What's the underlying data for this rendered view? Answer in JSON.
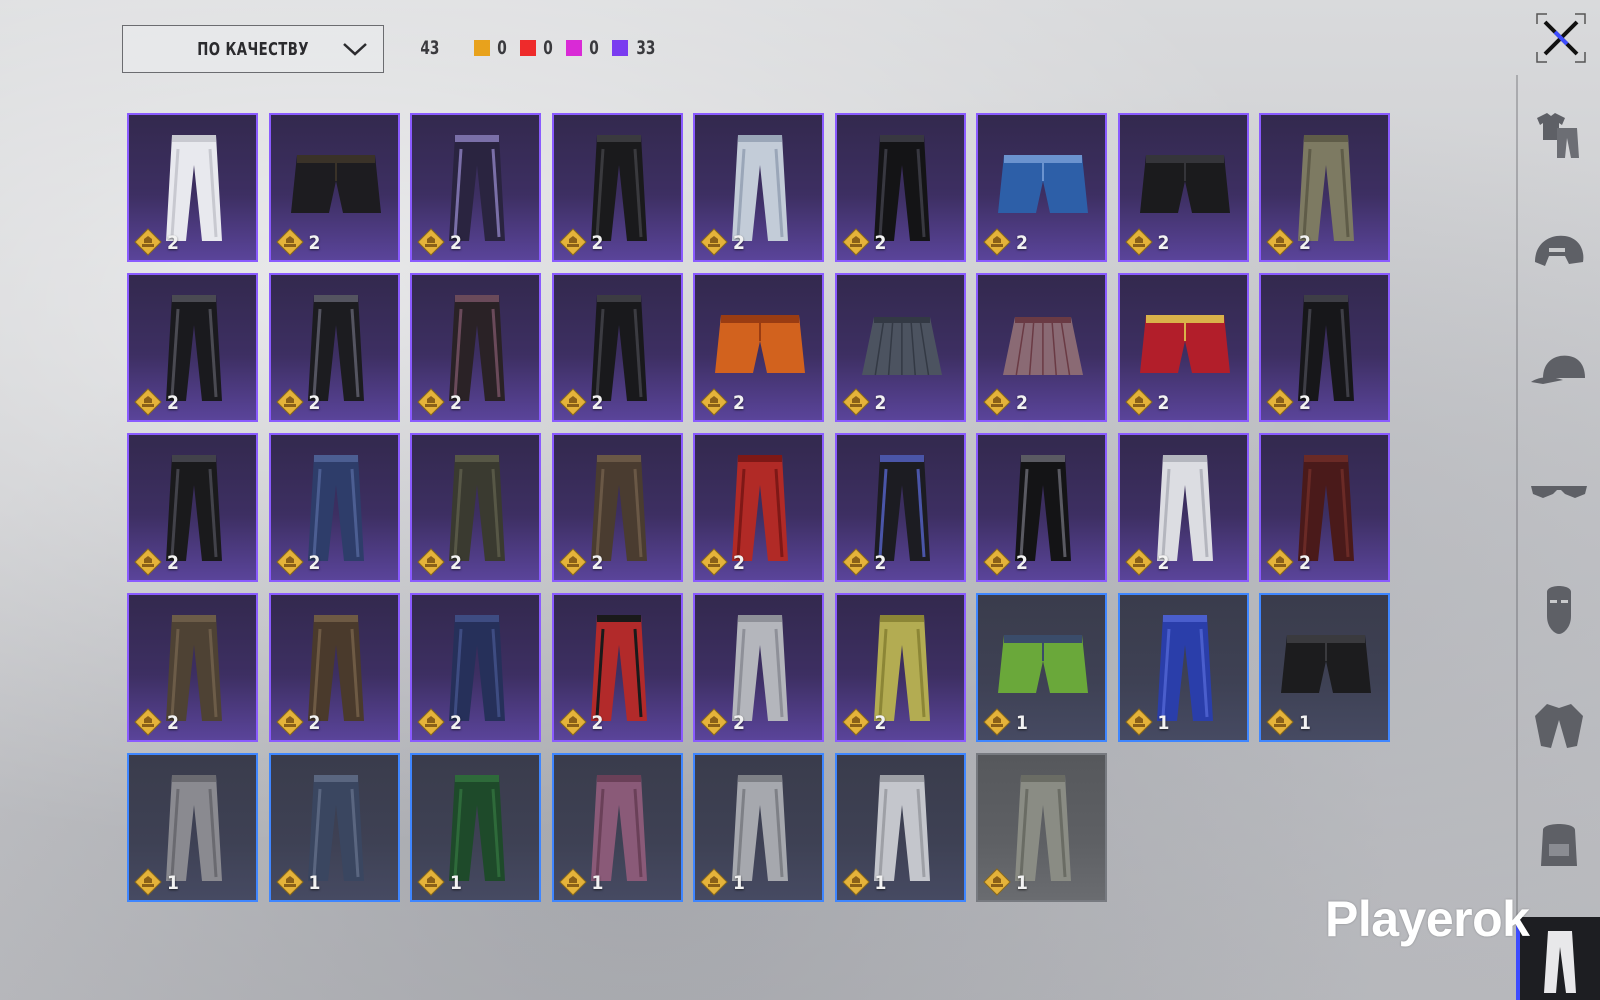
{
  "sort": {
    "label": "ПО КАЧЕСТВУ"
  },
  "counts": {
    "total": "43",
    "by_quality": [
      {
        "color": "#e8a21c",
        "value": "0"
      },
      {
        "color": "#ee2b2b",
        "value": "0"
      },
      {
        "color": "#d92ad6",
        "value": "0"
      },
      {
        "color": "#7a3cf0",
        "value": "33"
      }
    ]
  },
  "colors": {
    "epic_border": "#8a5bff",
    "rare_border": "#3f86ff",
    "common_border": "#777a80",
    "badge": "#e5b33a"
  },
  "items": [
    {
      "icon": "white-flared-pants",
      "qty": "2",
      "q": "purple"
    },
    {
      "icon": "black-shorts-with-leggings",
      "qty": "2",
      "q": "purple"
    },
    {
      "icon": "camo-print-pants",
      "qty": "2",
      "q": "purple"
    },
    {
      "icon": "black-leather-pants",
      "qty": "2",
      "q": "purple"
    },
    {
      "icon": "light-denim-jeans",
      "qty": "2",
      "q": "purple"
    },
    {
      "icon": "black-tactical-pants",
      "qty": "2",
      "q": "purple"
    },
    {
      "icon": "blue-denim-shorts",
      "qty": "2",
      "q": "purple"
    },
    {
      "icon": "black-shorts-with-boots",
      "qty": "2",
      "q": "purple"
    },
    {
      "icon": "khaki-cargo-pants",
      "qty": "2",
      "q": "purple"
    },
    {
      "icon": "black-patterned-pants",
      "qty": "2",
      "q": "purple"
    },
    {
      "icon": "black-strap-pants",
      "qty": "2",
      "q": "purple"
    },
    {
      "icon": "dark-pink-trim-pants",
      "qty": "2",
      "q": "purple"
    },
    {
      "icon": "black-holster-pants",
      "qty": "2",
      "q": "purple"
    },
    {
      "icon": "orange-floral-shorts",
      "qty": "2",
      "q": "purple"
    },
    {
      "icon": "grey-mini-skirt",
      "qty": "2",
      "q": "purple"
    },
    {
      "icon": "plaid-pleated-skirt",
      "qty": "2",
      "q": "purple"
    },
    {
      "icon": "red-pubg-boxing-shorts",
      "qty": "2",
      "q": "purple"
    },
    {
      "icon": "black-star-pants",
      "qty": "2",
      "q": "purple"
    },
    {
      "icon": "black-leather-trousers",
      "qty": "2",
      "q": "purple"
    },
    {
      "icon": "blue-jeans",
      "qty": "2",
      "q": "purple"
    },
    {
      "icon": "dark-olive-pants",
      "qty": "2",
      "q": "purple"
    },
    {
      "icon": "brown-leather-pants",
      "qty": "2",
      "q": "purple"
    },
    {
      "icon": "red-trousers",
      "qty": "2",
      "q": "purple"
    },
    {
      "icon": "black-blue-armored-pants",
      "qty": "2",
      "q": "purple"
    },
    {
      "icon": "black-sequin-flared-pants",
      "qty": "2",
      "q": "purple"
    },
    {
      "icon": "white-biker-pants",
      "qty": "2",
      "q": "purple"
    },
    {
      "icon": "maroon-pants",
      "qty": "2",
      "q": "purple"
    },
    {
      "icon": "brown-cargo-pants",
      "qty": "2",
      "q": "purple"
    },
    {
      "icon": "brown-harem-pants",
      "qty": "2",
      "q": "purple"
    },
    {
      "icon": "navy-jeans",
      "qty": "2",
      "q": "purple"
    },
    {
      "icon": "red-black-training-pants",
      "qty": "2",
      "q": "purple"
    },
    {
      "icon": "grey-track-pants",
      "qty": "2",
      "q": "purple"
    },
    {
      "icon": "yellow-sweatpants",
      "qty": "2",
      "q": "purple"
    },
    {
      "icon": "green-denim-shorts",
      "qty": "1",
      "q": "blue"
    },
    {
      "icon": "blue-track-pants",
      "qty": "1",
      "q": "blue"
    },
    {
      "icon": "black-shorts",
      "qty": "1",
      "q": "blue"
    },
    {
      "icon": "grey-slim-pants",
      "qty": "1",
      "q": "blue"
    },
    {
      "icon": "dark-jeans",
      "qty": "1",
      "q": "blue"
    },
    {
      "icon": "green-pants",
      "qty": "1",
      "q": "blue"
    },
    {
      "icon": "pink-pants",
      "qty": "1",
      "q": "blue"
    },
    {
      "icon": "grey-camo-pants",
      "qty": "1",
      "q": "blue"
    },
    {
      "icon": "light-grey-pants",
      "qty": "1",
      "q": "blue"
    },
    {
      "icon": "grey-worn-pants",
      "qty": "1",
      "q": "grey"
    }
  ],
  "sidebar": {
    "tabs": [
      "tshirt-pants-icon",
      "helmet-icon",
      "cap-icon",
      "glasses-icon",
      "mask-icon",
      "jacket-icon",
      "backpack-icon"
    ],
    "active": "pants-icon"
  },
  "close_icon": "close-icon",
  "watermark": "Playerok"
}
